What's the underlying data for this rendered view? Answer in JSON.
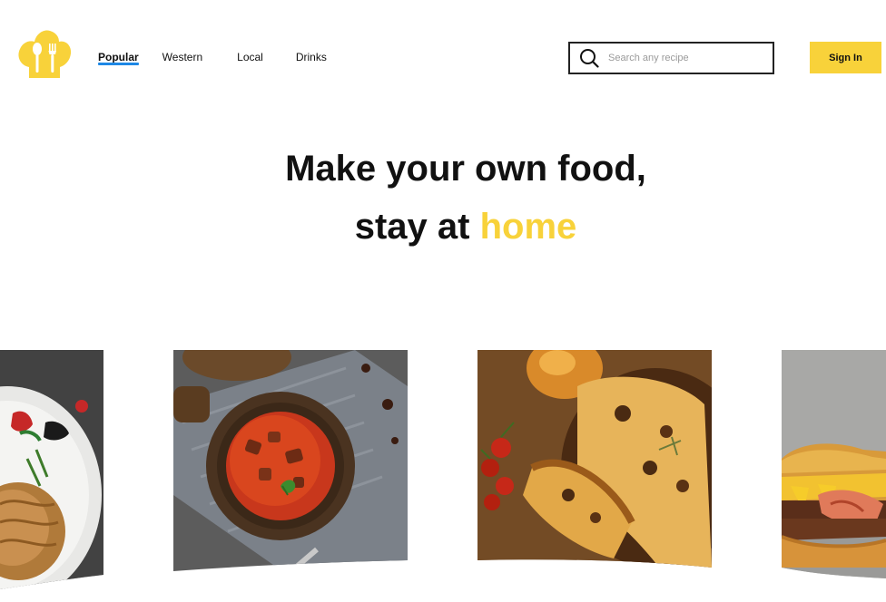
{
  "header": {
    "nav": [
      {
        "label": "Popular",
        "active": true
      },
      {
        "label": "Western",
        "active": false
      },
      {
        "label": "Local",
        "active": false
      },
      {
        "label": "Drinks",
        "active": false
      }
    ],
    "search": {
      "placeholder": "Search any recipe",
      "value": ""
    },
    "signin_label": "Sign In"
  },
  "hero": {
    "line1": "Make your own food,",
    "line2_prefix": "stay at ",
    "line2_accent": "home"
  },
  "cards": [
    {
      "icon": "dish-photo",
      "subject": "noodle plate"
    },
    {
      "icon": "dish-photo",
      "subject": "tomato soup"
    },
    {
      "icon": "dish-photo",
      "subject": "pizza"
    },
    {
      "icon": "dish-photo",
      "subject": "burger"
    }
  ],
  "colors": {
    "accent": "#f8d23a",
    "nav_underline": "#1e88e5",
    "text": "#111111"
  }
}
